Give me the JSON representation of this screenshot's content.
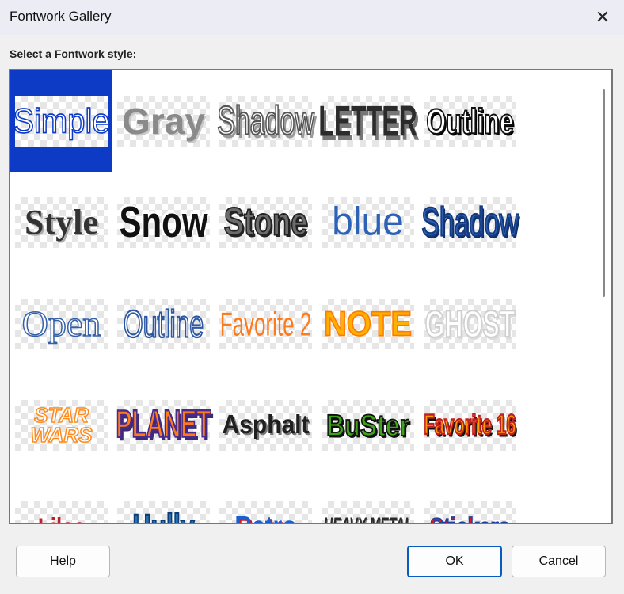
{
  "window": {
    "title": "Fontwork Gallery",
    "close_glyph": "✕"
  },
  "gallery": {
    "label": "Select a Fontwork style:",
    "selected_index": 0,
    "items": [
      {
        "text": "Simple",
        "color": "#ffffff",
        "stroke": "#0d3bc6",
        "family": "\"Liberation Sans\", sans-serif",
        "size": 40,
        "weight": "normal",
        "style": "normal",
        "scaleY": 1.1
      },
      {
        "text": "Gray",
        "color": "#8a8a8a",
        "stroke": "",
        "family": "\"Liberation Sans\", sans-serif",
        "size": 46,
        "weight": "bold",
        "style": "normal",
        "scaleY": 1.0,
        "shadow": "2px 2px 0 #c8c8c8"
      },
      {
        "text": "Shadow",
        "color": "#ffffff",
        "stroke": "#555555",
        "family": "\"Liberation Sans\", sans-serif",
        "size": 34,
        "weight": "normal",
        "style": "normal",
        "scaleY": 1.5,
        "shadow": "3px 3px 0 #9a9a9a"
      },
      {
        "text": "LETTER",
        "color": "#2b2b2b",
        "stroke": "",
        "family": "\"Liberation Sans\", sans-serif",
        "size": 32,
        "weight": "bold",
        "style": "normal",
        "scaleY": 1.7,
        "shadow": "3px 3px 0 #777"
      },
      {
        "text": "Outline",
        "color": "#ffffff",
        "stroke": "#111111",
        "family": "\"Liberation Sans\", sans-serif",
        "size": 32,
        "weight": "bold",
        "style": "normal",
        "scaleY": 1.4,
        "shadow": "2px 2px 0 #000"
      },
      {
        "text": "Style",
        "color": "#333333",
        "stroke": "",
        "family": "\"Liberation Serif\", serif",
        "size": 44,
        "weight": "bold",
        "style": "normal",
        "scaleY": 1.0,
        "shadow": "2px 2px 0 #aaa"
      },
      {
        "text": "Snow",
        "color": "#111111",
        "stroke": "",
        "family": "\"Liberation Sans\", sans-serif",
        "size": 42,
        "weight": "bold",
        "style": "normal",
        "scaleY": 1.3,
        "shadow": "-2px -2px 0 #fff"
      },
      {
        "text": "Stone",
        "color": "#6b6b6b",
        "stroke": "#222",
        "family": "\"Liberation Sans\", sans-serif",
        "size": 38,
        "weight": "bold",
        "style": "normal",
        "scaleY": 1.3,
        "shadow": "2px 2px 0 #222"
      },
      {
        "text": "blue",
        "color": "#2d63b6",
        "stroke": "",
        "family": "\"Liberation Sans\", sans-serif",
        "size": 48,
        "weight": "normal",
        "style": "normal",
        "scaleY": 1.05
      },
      {
        "text": "Shadow",
        "color": "#2f5db0",
        "stroke": "#123a80",
        "family": "\"Liberation Sans\", sans-serif",
        "size": 34,
        "weight": "normal",
        "style": "normal",
        "scaleY": 1.5,
        "shadow": "2px 2px 0 #0f2f6a"
      },
      {
        "text": "Open",
        "color": "#ffffff",
        "stroke": "#3560a8",
        "family": "\"Liberation Serif\", serif",
        "size": 46,
        "weight": "normal",
        "style": "normal",
        "scaleY": 1.0
      },
      {
        "text": "Outline",
        "color": "#ffffff",
        "stroke": "#2c57a2",
        "family": "\"Liberation Sans\", sans-serif",
        "size": 32,
        "weight": "normal",
        "style": "normal",
        "scaleY": 1.5
      },
      {
        "text": "Favorite 2",
        "color": "#ff7a1a",
        "stroke": "",
        "family": "\"Liberation Sans\", sans-serif",
        "size": 26,
        "weight": "normal",
        "style": "normal",
        "scaleY": 1.6
      },
      {
        "text": "NOTE",
        "color": "#ffb000",
        "stroke": "#ff7a00",
        "family": "\"Liberation Sans\", sans-serif",
        "size": 40,
        "weight": "bold",
        "style": "normal",
        "scaleY": 1.1
      },
      {
        "text": "GHOST",
        "color": "#ffffff",
        "stroke": "#cfcfcf",
        "family": "\"Liberation Sans\", sans-serif",
        "size": 32,
        "weight": "bold",
        "style": "normal",
        "scaleY": 1.5,
        "shadow": "2px 2px 0 #dcdcdc"
      },
      {
        "text": "STAR\nWARS",
        "color": "#ffffff",
        "stroke": "#ff8a1a",
        "family": "\"Liberation Sans\", sans-serif",
        "size": 26,
        "weight": "bold",
        "style": "italic",
        "scaleY": 1.0
      },
      {
        "text": "PLANET",
        "color": "#ff7a1a",
        "stroke": "#4a2a8a",
        "family": "\"Liberation Sans\", sans-serif",
        "size": 30,
        "weight": "bold",
        "style": "normal",
        "scaleY": 1.6,
        "shadow": "3px 3px 0 #3f2a7a"
      },
      {
        "text": "Asphalt",
        "color": "#1f1f1f",
        "stroke": "",
        "family": "\"Liberation Sans\", sans-serif",
        "size": 30,
        "weight": "bold",
        "style": "normal",
        "scaleY": 1.1,
        "shadow": "2px 2px 0 #777"
      },
      {
        "text": "BuSter",
        "color": "#3fa21a",
        "stroke": "#111",
        "family": "\"Liberation Sans\", sans-serif",
        "size": 32,
        "weight": "bold",
        "style": "normal",
        "scaleY": 1.2,
        "shadow": "2px 2px 0 #111"
      },
      {
        "text": "Favorite 16",
        "color": "#ff9a00",
        "stroke": "#c02020",
        "family": "\"Liberation Sans\", sans-serif",
        "size": 22,
        "weight": "bold",
        "style": "normal",
        "scaleY": 1.6,
        "shadow": "2px 2px 0 #111"
      },
      {
        "text": "Lilac",
        "color": "#c0202a",
        "stroke": "",
        "family": "\"Liberation Sans\", sans-serif",
        "size": 26,
        "weight": "bold",
        "style": "normal",
        "scaleY": 1.2
      },
      {
        "text": "Hully",
        "color": "#2a6fb0",
        "stroke": "#0c3d73",
        "family": "\"Liberation Sans\", sans-serif",
        "size": 32,
        "weight": "bold",
        "style": "normal",
        "scaleY": 1.4
      },
      {
        "text": "Retro",
        "color": "#1a5fd0",
        "stroke": "",
        "family": "\"Liberation Sans\", sans-serif",
        "size": 30,
        "weight": "bold",
        "style": "normal",
        "scaleY": 1.1,
        "shadow": "2px 2px 0 #d21a1a"
      },
      {
        "text": "HEAVY METAL",
        "color": "#2b2b2b",
        "stroke": "",
        "family": "\"Liberation Sans\", sans-serif",
        "size": 16,
        "weight": "bold",
        "style": "italic",
        "scaleY": 1.7,
        "shadow": "1px 1px 0 #888"
      },
      {
        "text": "Stickers",
        "color": "#d02030",
        "stroke": "#2040a0",
        "family": "\"Liberation Sans\", sans-serif",
        "size": 26,
        "weight": "bold",
        "style": "normal",
        "scaleY": 1.2
      }
    ]
  },
  "buttons": {
    "help": "Help",
    "ok": "OK",
    "cancel": "Cancel"
  }
}
